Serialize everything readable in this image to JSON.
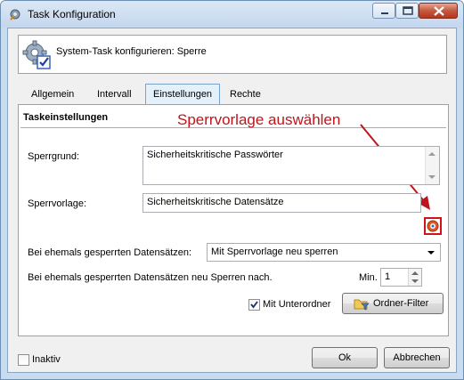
{
  "window": {
    "title": "Task Konfiguration",
    "icons": {
      "app": "wrench-gear-icon",
      "minimize": "minimize-icon",
      "maximize": "maximize-icon",
      "close": "close-icon"
    }
  },
  "header": {
    "icon": "gear-check-icon",
    "text": "System-Task konfigurieren: Sperre"
  },
  "tabs": [
    {
      "label": "Allgemein",
      "active": false
    },
    {
      "label": "Intervall",
      "active": false
    },
    {
      "label": "Einstellungen",
      "active": true
    },
    {
      "label": "Rechte",
      "active": false
    }
  ],
  "section": {
    "title": "Taskeinstellungen",
    "annotation": "Sperrvorlage auswählen",
    "annotation_color": "#c0141c"
  },
  "form": {
    "sperrgrund_label": "Sperrgrund:",
    "sperrgrund_value": "Sicherheitskritische Passwörter",
    "sperrvorlage_label": "Sperrvorlage:",
    "sperrvorlage_value": "Sicherheitskritische Datensätze",
    "sperrvorlage_button_icon": "template-picker-icon",
    "ehemals_label": "Bei ehemals gesperrten Datensätzen:",
    "ehemals_value": "Mit Sperrvorlage neu sperren",
    "neusperren_label": "Bei ehemals gesperrten Datensätzen neu Sperren nach.",
    "min_label": "Min.",
    "min_value": "1",
    "unterordner_label": "Mit Unterordner",
    "unterordner_checked": true,
    "ordner_filter_label": "Ordner-Filter",
    "ordner_filter_icon": "folder-filter-icon"
  },
  "footer": {
    "inaktiv_label": "Inaktiv",
    "inaktiv_checked": false,
    "ok_label": "Ok",
    "cancel_label": "Abbrechen"
  }
}
